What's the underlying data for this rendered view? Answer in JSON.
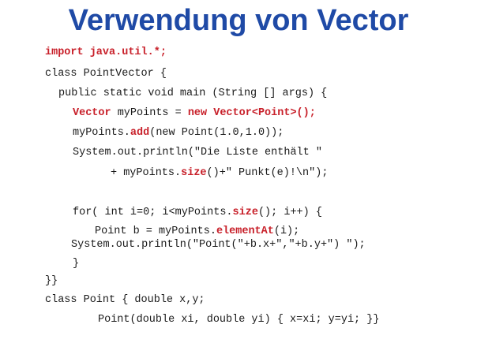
{
  "slide": {
    "title": "Verwendung von Vector"
  },
  "code": {
    "lines": [
      {
        "id": "line-import",
        "segments": [
          {
            "text": "import java.util.*;",
            "style": "red"
          }
        ]
      },
      {
        "id": "line-class-pointvector",
        "segments": [
          {
            "text": "class PointVector {",
            "style": "plain"
          }
        ]
      },
      {
        "id": "line-main-signature",
        "segments": [
          {
            "text": "public static void main (String [] args) {",
            "style": "plain"
          }
        ]
      },
      {
        "id": "line-vector-decl",
        "segments": [
          {
            "text": "Vector",
            "style": "red"
          },
          {
            "text": " myPoints = ",
            "style": "plain"
          },
          {
            "text": "new Vector<Point>();",
            "style": "red"
          }
        ]
      },
      {
        "id": "line-add",
        "segments": [
          {
            "text": "myPoints.",
            "style": "plain"
          },
          {
            "text": "add",
            "style": "red"
          },
          {
            "text": "(new Point(1.0,1.0));",
            "style": "plain"
          }
        ]
      },
      {
        "id": "line-println-1",
        "segments": [
          {
            "text": "System.out.println(\"Die Liste enthält \"",
            "style": "plain"
          }
        ]
      },
      {
        "id": "line-println-2",
        "segments": [
          {
            "text": "+ myPoints.",
            "style": "plain"
          },
          {
            "text": "size",
            "style": "red"
          },
          {
            "text": "()+\" Punkt(e)!\\n\");",
            "style": "plain"
          }
        ]
      },
      {
        "id": "line-for",
        "segments": [
          {
            "text": "for( int i=0; i<myPoints.",
            "style": "plain"
          },
          {
            "text": "size",
            "style": "red"
          },
          {
            "text": "(); i++) {",
            "style": "plain"
          }
        ]
      },
      {
        "id": "line-point-b",
        "segments": [
          {
            "text": "Point b = myPoints.",
            "style": "plain"
          },
          {
            "text": "elementAt",
            "style": "red"
          },
          {
            "text": "(i);",
            "style": "plain"
          }
        ]
      },
      {
        "id": "line-println-point",
        "segments": [
          {
            "text": "System.out.println(\"Point(\"+b.x+\",\"+b.y+\") \");",
            "style": "plain"
          }
        ]
      },
      {
        "id": "line-close-for",
        "segments": [
          {
            "text": "}",
            "style": "plain"
          }
        ]
      },
      {
        "id": "line-close-class",
        "segments": [
          {
            "text": "}}",
            "style": "plain"
          }
        ]
      },
      {
        "id": "line-class-point",
        "segments": [
          {
            "text": "class Point { double x,y;",
            "style": "plain"
          }
        ]
      },
      {
        "id": "line-point-ctor",
        "segments": [
          {
            "text": "Point(double xi, double yi) { x=xi; y=yi; }}",
            "style": "plain"
          }
        ]
      }
    ]
  }
}
